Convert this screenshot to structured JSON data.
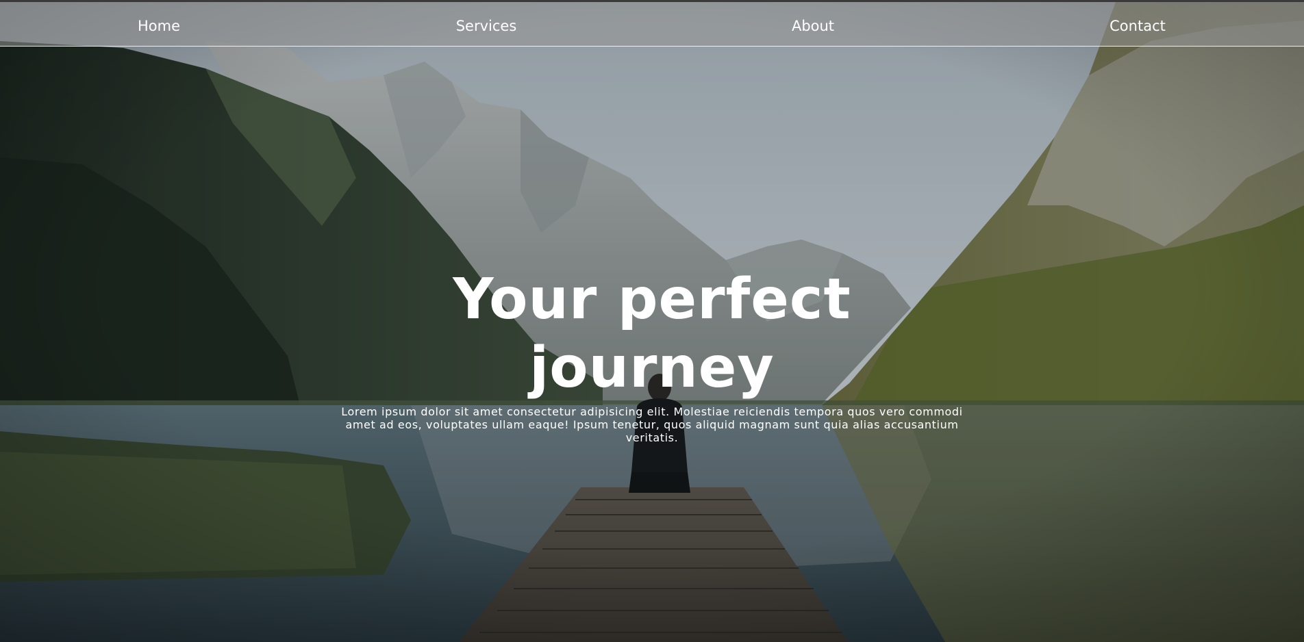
{
  "nav": {
    "items": [
      {
        "label": "Home"
      },
      {
        "label": "Services"
      },
      {
        "label": "About"
      },
      {
        "label": "Contact"
      }
    ]
  },
  "hero": {
    "title": "Your perfect journey",
    "description": "Lorem ipsum dolor sit amet consectetur adipisicing elit. Molestiae reiciendis tempora quos vero commodi amet ad eos, voluptates ullam eaque! Ipsum tenetur, quos aliquid magnam sunt quia alias accusantium veritatis.",
    "background": "mountain-lake-landscape-photo"
  },
  "colors": {
    "nav_background": "#969696",
    "text": "#ffffff",
    "sky": "#b9c3cc",
    "water": "#3e5560"
  }
}
